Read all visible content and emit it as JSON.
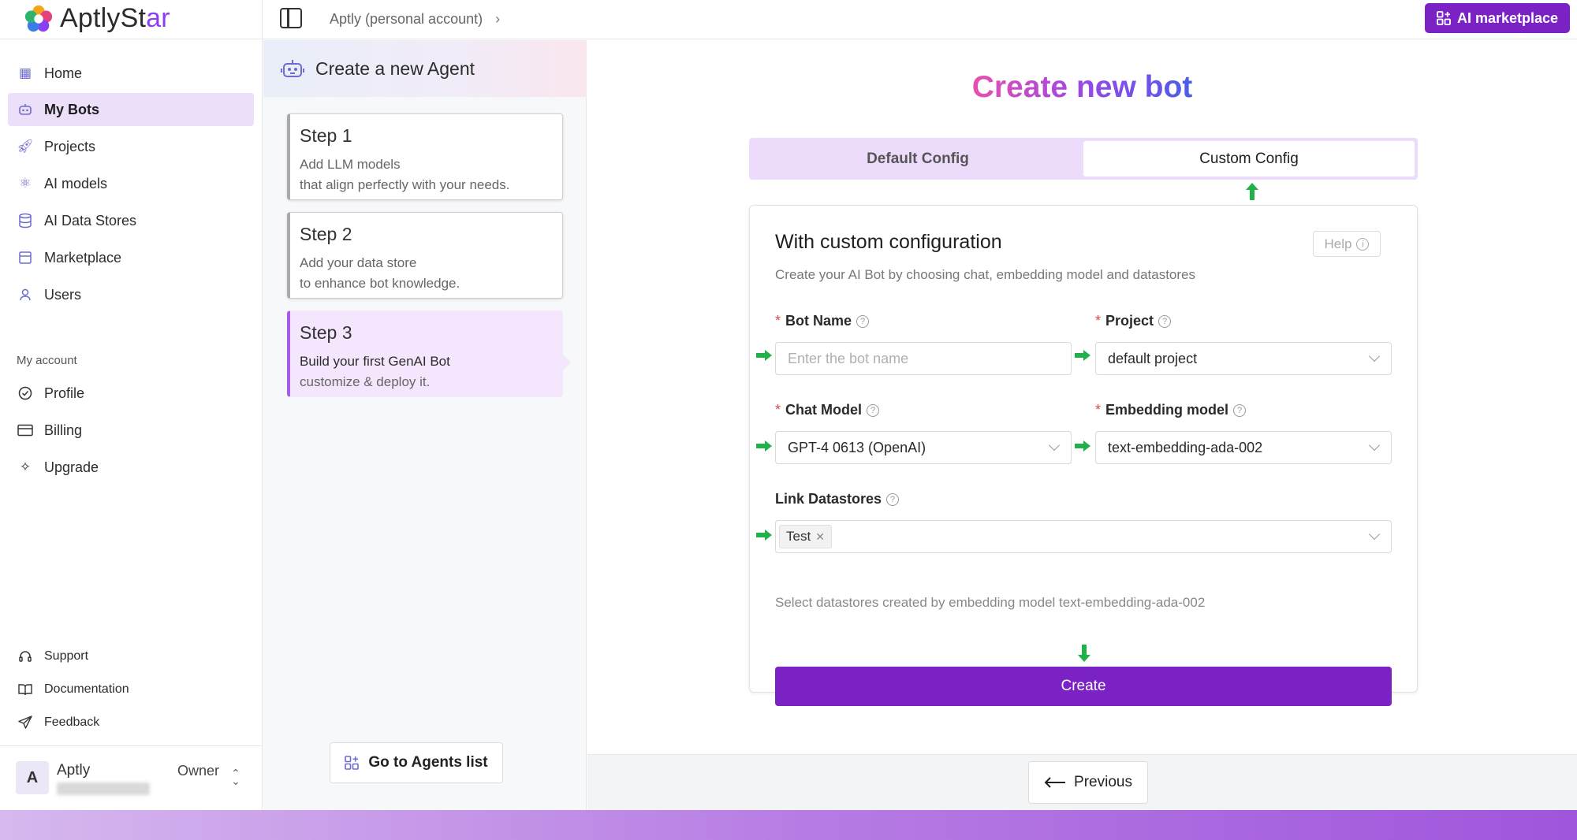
{
  "app": {
    "logo_text_main": "AptlySt",
    "logo_text_star": "ar",
    "breadcrumb": "Aptly (personal account)",
    "marketplace_button": "AI marketplace"
  },
  "sidebar": {
    "items": [
      {
        "label": "Home",
        "icon": "home-icon"
      },
      {
        "label": "My Bots",
        "icon": "bot-icon"
      },
      {
        "label": "Projects",
        "icon": "rocket-icon"
      },
      {
        "label": "AI models",
        "icon": "atom-icon"
      },
      {
        "label": "AI Data Stores",
        "icon": "database-icon"
      },
      {
        "label": "Marketplace",
        "icon": "store-icon"
      },
      {
        "label": "Users",
        "icon": "user-icon"
      }
    ],
    "account_section": "My account",
    "account_items": [
      {
        "label": "Profile",
        "icon": "profile-check-icon"
      },
      {
        "label": "Billing",
        "icon": "card-icon"
      },
      {
        "label": "Upgrade",
        "icon": "sparkle-icon"
      }
    ],
    "footer_items": [
      {
        "label": "Support",
        "icon": "headset-icon"
      },
      {
        "label": "Documentation",
        "icon": "book-icon"
      },
      {
        "label": "Feedback",
        "icon": "send-icon"
      }
    ],
    "user": {
      "initial": "A",
      "name": "Aptly",
      "role": "Owner"
    }
  },
  "wizard": {
    "title": "Create a new Agent",
    "steps": [
      {
        "title": "Step 1",
        "line1": "Add LLM models",
        "line2": "that align perfectly with your needs."
      },
      {
        "title": "Step 2",
        "line1": "Add your data store",
        "line2": "to enhance bot knowledge."
      },
      {
        "title": "Step 3",
        "line1": "Build your first GenAI Bot",
        "line2": "customize & deploy it."
      }
    ],
    "go_agents_label": "Go to Agents list"
  },
  "main": {
    "title": "Create new bot",
    "tabs": [
      "Default Config",
      "Custom Config"
    ],
    "card_title": "With custom configuration",
    "help_label": "Help",
    "card_subtitle": "Create your AI Bot by choosing chat, embedding model and datastores",
    "fields": {
      "bot_name": {
        "label": "Bot Name",
        "placeholder": "Enter the bot name"
      },
      "project": {
        "label": "Project",
        "value": "default project"
      },
      "chat_model": {
        "label": "Chat Model",
        "value": "GPT-4 0613 (OpenAI)"
      },
      "embedding_model": {
        "label": "Embedding model",
        "value": "text-embedding-ada-002"
      },
      "datastores": {
        "label": "Link Datastores",
        "tag": "Test",
        "hint": "Select datastores created by embedding model text-embedding-ada-002"
      }
    },
    "create_label": "Create",
    "previous_label": "Previous"
  },
  "colors": {
    "accent": "#7a22c4",
    "active_nav": "#ecdffa",
    "arrow_green": "#22b04b"
  }
}
